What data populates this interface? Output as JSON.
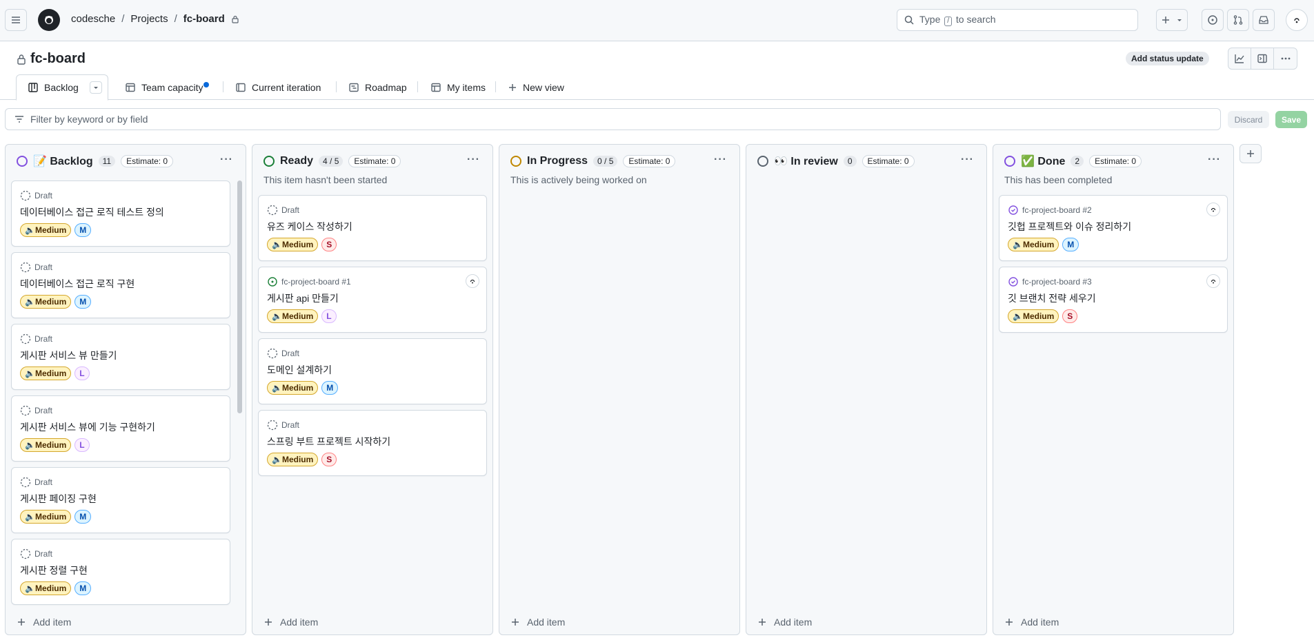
{
  "header": {
    "breadcrumbs": [
      "codesche",
      "Projects",
      "fc-board"
    ],
    "search_prefix": "Type",
    "search_key": "/",
    "search_suffix": "to search"
  },
  "project": {
    "title": "fc-board",
    "status_update_label": "Add status update"
  },
  "tabs": [
    {
      "label": "Backlog",
      "active": true
    },
    {
      "label": "Team capacity",
      "indicator": true
    },
    {
      "label": "Current iteration"
    },
    {
      "label": "Roadmap"
    },
    {
      "label": "My items"
    },
    {
      "label": "New view"
    }
  ],
  "filter": {
    "placeholder": "Filter by keyword or by field",
    "discard_label": "Discard",
    "save_label": "Save"
  },
  "colors": {
    "backlog": "#8250df",
    "ready": "#1a7f37",
    "in_progress": "#bf8700",
    "in_review": "#59636e",
    "done": "#8250df"
  },
  "columns": [
    {
      "name": "📝 Backlog",
      "count": "11",
      "estimate": "Estimate: 0",
      "description": "",
      "add_label": "Add item",
      "cards": [
        {
          "meta": "Draft",
          "title": "데이터베이스 접근 로직 테스트 정의",
          "priority": "🔈Medium",
          "size": "M"
        },
        {
          "meta": "Draft",
          "title": "데이터베이스 접근 로직 구현",
          "priority": "🔈Medium",
          "size": "M"
        },
        {
          "meta": "Draft",
          "title": "게시판 서비스 뷰 만들기",
          "priority": "🔈Medium",
          "size": "L"
        },
        {
          "meta": "Draft",
          "title": "게시판 서비스 뷰에 기능 구현하기",
          "priority": "🔈Medium",
          "size": "L"
        },
        {
          "meta": "Draft",
          "title": "게시판 페이징 구현",
          "priority": "🔈Medium",
          "size": "M"
        },
        {
          "meta": "Draft",
          "title": "게시판 정렬 구현",
          "priority": "🔈Medium",
          "size": "M"
        }
      ]
    },
    {
      "name": "Ready",
      "count": "4 / 5",
      "estimate": "Estimate: 0",
      "description": "This item hasn't been started",
      "add_label": "Add item",
      "cards": [
        {
          "meta": "Draft",
          "title": "유즈 케이스 작성하기",
          "priority": "🔈Medium",
          "size": "S"
        },
        {
          "meta": "fc-project-board #1",
          "title": "게시판 api 만들기",
          "priority": "🔈Medium",
          "size": "L",
          "issue": "open"
        },
        {
          "meta": "Draft",
          "title": "도메인 설계하기",
          "priority": "🔈Medium",
          "size": "M"
        },
        {
          "meta": "Draft",
          "title": "스프링 부트 프로젝트 시작하기",
          "priority": "🔈Medium",
          "size": "S"
        }
      ]
    },
    {
      "name": "In Progress",
      "count": "0 / 5",
      "estimate": "Estimate: 0",
      "description": "This is actively being worked on",
      "add_label": "Add item",
      "cards": []
    },
    {
      "name": "👀 In review",
      "count": "0",
      "estimate": "Estimate: 0",
      "description": "",
      "add_label": "Add item",
      "cards": []
    },
    {
      "name": "✅ Done",
      "count": "2",
      "estimate": "Estimate: 0",
      "description": "This has been completed",
      "add_label": "Add item",
      "cards": [
        {
          "meta": "fc-project-board #2",
          "title": "깃헙 프로젝트와 이슈 정리하기",
          "priority": "🔈Medium",
          "size": "M",
          "issue": "closed"
        },
        {
          "meta": "fc-project-board #3",
          "title": "깃 브랜치 전략 세우기",
          "priority": "🔈Medium",
          "size": "S",
          "issue": "closed"
        }
      ]
    }
  ]
}
